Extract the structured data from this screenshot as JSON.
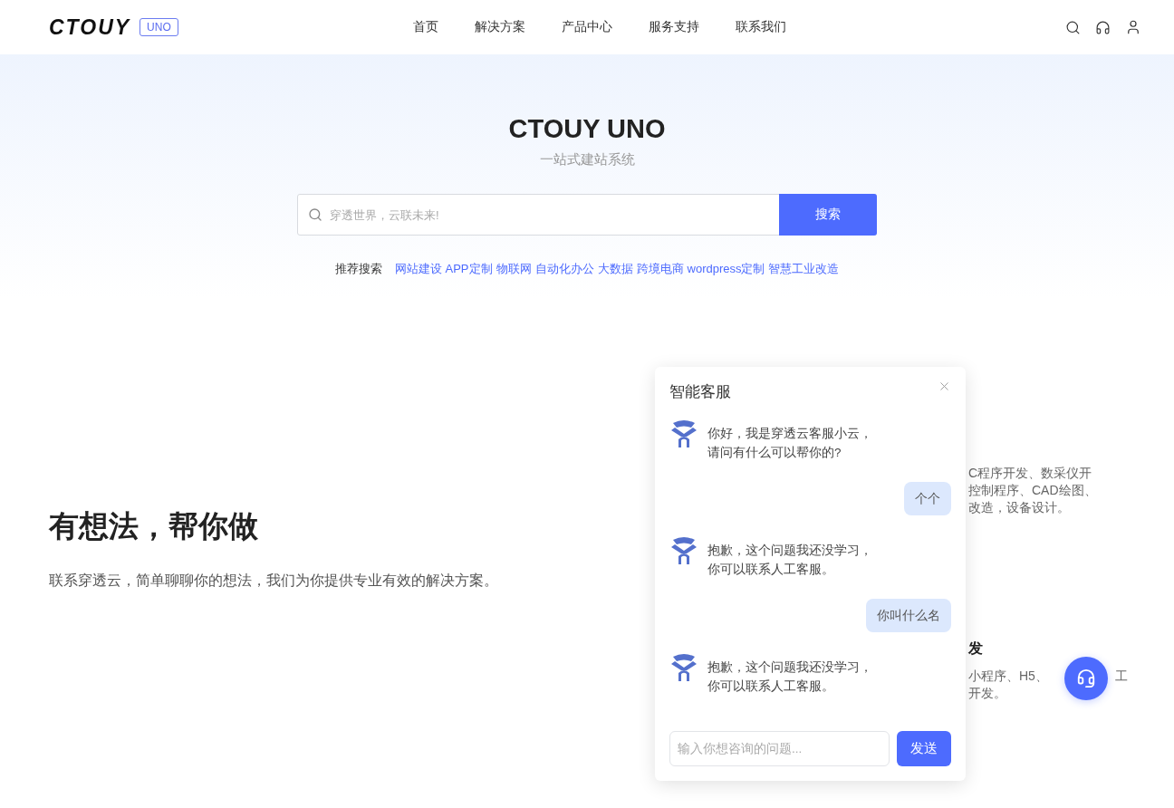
{
  "header": {
    "logo": "CTOUY",
    "badge": "UNO",
    "nav": [
      {
        "label": "首页"
      },
      {
        "label": "解决方案"
      },
      {
        "label": "产品中心"
      },
      {
        "label": "服务支持"
      },
      {
        "label": "联系我们"
      }
    ]
  },
  "hero": {
    "title": "CTOUY UNO",
    "subtitle": "一站式建站系统",
    "search": {
      "placeholder": "穿透世界，云联未来!",
      "button": "搜索"
    },
    "recommend_label": "推荐搜索",
    "recommend": [
      "网站建设",
      "APP定制",
      "物联网",
      "自动化办公",
      "大数据",
      "跨境电商",
      "wordpress定制",
      "智慧工业改造"
    ]
  },
  "intro": {
    "title": "有想法，帮你做",
    "text": "联系穿透云，简单聊聊你的想法，我们为你提供专业有效的解决方案。"
  },
  "cards": [
    {
      "lines": [
        "C程序开发、数采仪开",
        "控制程序、CAD绘图、",
        "改造，设备设计。"
      ]
    },
    {
      "title": "发",
      "lines": [
        "小程序、H5、",
        "开发。"
      ],
      "tail": "工"
    }
  ],
  "chat": {
    "title": "智能客服",
    "messages": [
      {
        "kind": "bot",
        "lines": [
          "你好，我是穿透云客服小云，",
          "请问有什么可以帮你的?"
        ]
      },
      {
        "kind": "user",
        "lines": [
          "个个"
        ]
      },
      {
        "kind": "bot",
        "lines": [
          "抱歉，这个问题我还没学习，",
          "你可以联系人工客服。"
        ]
      },
      {
        "kind": "user",
        "lines": [
          "你叫什么名"
        ]
      },
      {
        "kind": "bot",
        "lines": [
          "抱歉，这个问题我还没学习，",
          "你可以联系人工客服。"
        ]
      }
    ],
    "input": {
      "placeholder": "输入你想咨询的问题..."
    },
    "send": "发送"
  }
}
